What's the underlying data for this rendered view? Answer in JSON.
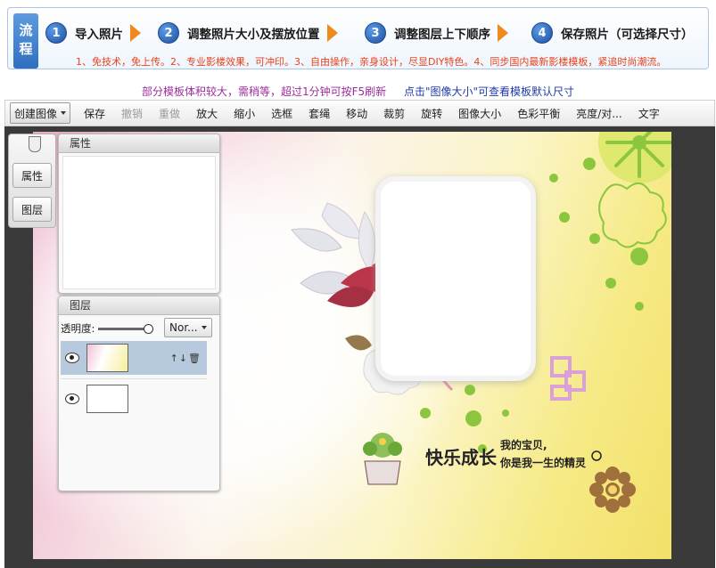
{
  "banner": {
    "tag": "流程",
    "steps": [
      {
        "num": "1",
        "label": "导入照片"
      },
      {
        "num": "2",
        "label": "调整照片大小及摆放位置"
      },
      {
        "num": "3",
        "label": "调整图层上下顺序"
      },
      {
        "num": "4",
        "label": "保存照片（可选择尺寸）"
      }
    ],
    "note": "1、免技术，免上传。2、专业影楼效果，可冲印。3、自由操作，亲身设计，尽显DIY特色。4、同步国内最新影楼模板，紧追时尚潮流。"
  },
  "notice": {
    "left": "部分模板体积较大，需稍等，超过1分钟可按F5刷新",
    "right": "点击\"图像大小\"可查看模板默认尺寸"
  },
  "toolbar": {
    "create": "创建图像",
    "items": [
      "保存",
      "撤销",
      "重做",
      "放大",
      "缩小",
      "选框",
      "套绳",
      "移动",
      "裁剪",
      "旋转",
      "图像大小",
      "色彩平衡",
      "亮度/对...",
      "文字"
    ]
  },
  "side_tabs": {
    "properties": "属性",
    "layers": "图层"
  },
  "properties_panel": {
    "title": "属性"
  },
  "layers_panel": {
    "title": "图层",
    "opacity_label": "透明度:",
    "opacity": 1.0,
    "blend_mode": "Nor...",
    "layer_ops": "↑↓🗑"
  },
  "canvas": {
    "caption_title": "快乐成长",
    "caption_sub1": "我的宝贝,",
    "caption_sub2": "你是我一生的精灵"
  }
}
